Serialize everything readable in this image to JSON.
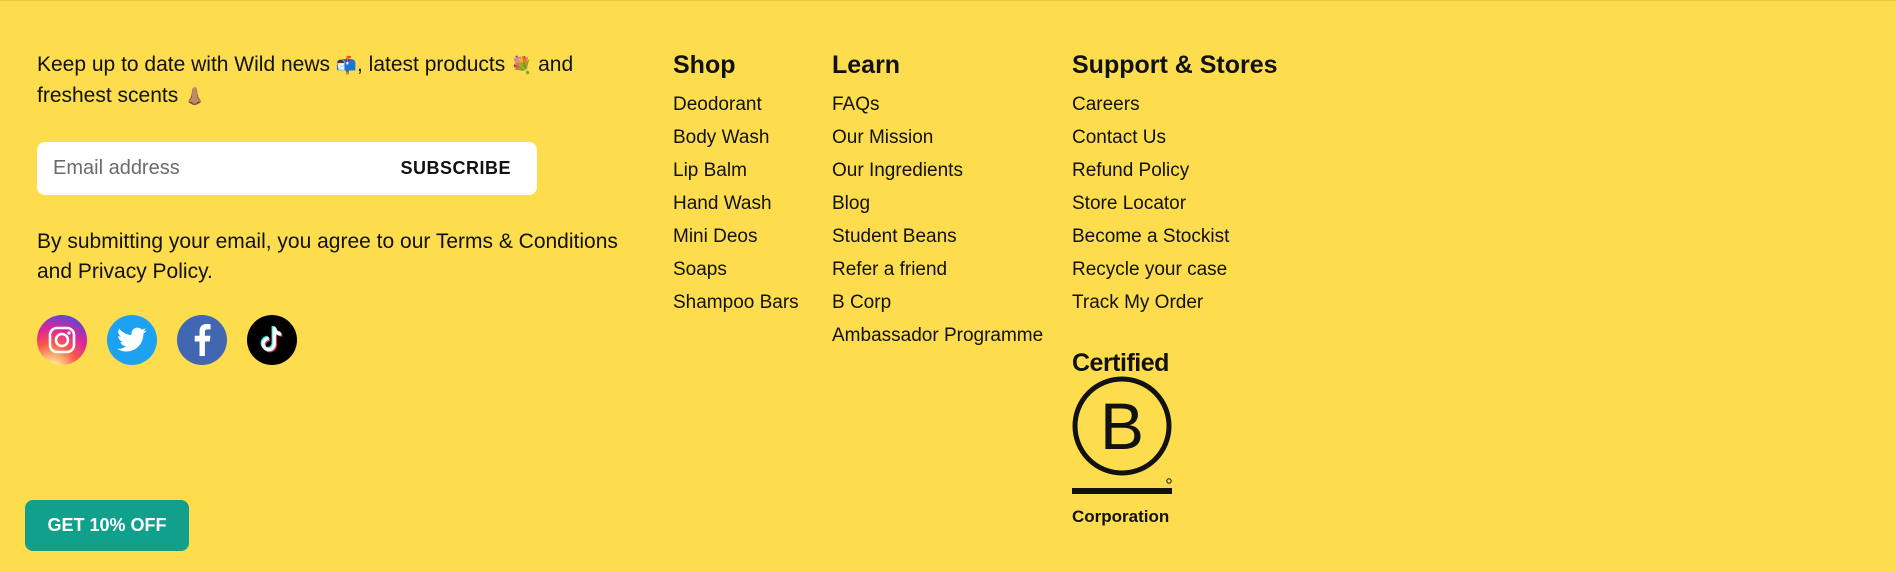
{
  "newsletter": {
    "intro_part1": "Keep up to date with Wild news",
    "emoji1": "📬",
    "intro_part2": ", latest products",
    "emoji2": "💐",
    "intro_part3": "and freshest scents",
    "emoji3": "👃🏽",
    "email_placeholder": "Email address",
    "subscribe_label": "SUBSCRIBE",
    "consent": "By submitting your email, you agree to our Terms & Conditions and Privacy Policy."
  },
  "social": [
    {
      "name": "instagram-icon",
      "color": "#e1306c"
    },
    {
      "name": "twitter-icon",
      "color": "#1da1f2"
    },
    {
      "name": "facebook-icon",
      "color": "#4267b2"
    },
    {
      "name": "tiktok-icon",
      "color": "#000000"
    }
  ],
  "shop": {
    "heading": "Shop",
    "items": [
      "Deodorant",
      "Body Wash",
      "Lip Balm",
      "Hand Wash",
      "Mini Deos",
      "Soaps",
      "Shampoo Bars"
    ]
  },
  "learn": {
    "heading": "Learn",
    "items": [
      "FAQs",
      "Our Mission",
      "Our Ingredients",
      "Blog",
      "Student Beans",
      "Refer a friend",
      "B Corp",
      "Ambassador Programme"
    ]
  },
  "support": {
    "heading": "Support & Stores",
    "items": [
      "Careers",
      "Contact Us",
      "Refund Policy",
      "Store Locator",
      "Become a Stockist",
      "Recycle your case",
      "Track My Order"
    ]
  },
  "bcorp": {
    "top": "Certified",
    "letter": "B",
    "bottom": "Corporation"
  },
  "offer_button": "GET 10% OFF",
  "colors": {
    "background": "#fddd4d",
    "offer": "#10a08c"
  }
}
